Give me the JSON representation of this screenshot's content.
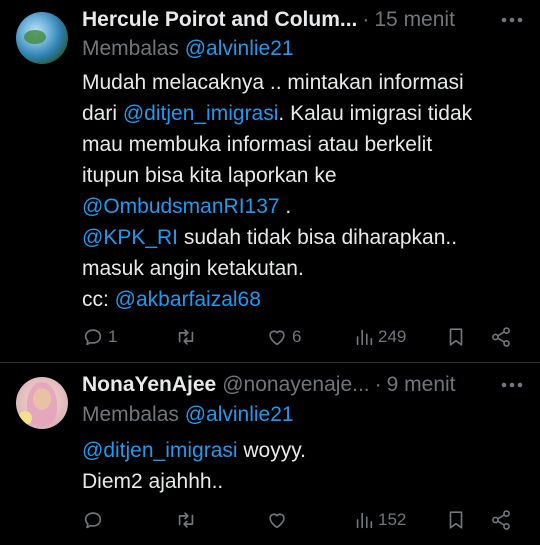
{
  "tweets": [
    {
      "author_name": "Hercule Poirot and Colum...",
      "handle": "",
      "separator": "·",
      "time": "15 menit",
      "replying_label": "Membalas",
      "replying_to": "@alvinlie21",
      "body_lines": [
        [
          {
            "t": "Mudah melacaknya .. mintakan informasi",
            "m": false
          }
        ],
        [
          {
            "t": "dari ",
            "m": false
          },
          {
            "t": "@ditjen_imigrasi",
            "m": true
          },
          {
            "t": ". Kalau imigrasi tidak",
            "m": false
          }
        ],
        [
          {
            "t": "mau membuka informasi atau berkelit",
            "m": false
          }
        ],
        [
          {
            "t": "itupun bisa kita laporkan ke",
            "m": false
          }
        ],
        [
          {
            "t": "@OmbudsmanRI137",
            "m": true
          },
          {
            "t": " .",
            "m": false
          }
        ],
        [
          {
            "t": "@KPK_RI",
            "m": true
          },
          {
            "t": " sudah tidak bisa diharapkan..",
            "m": false
          }
        ],
        [
          {
            "t": "masuk angin ketakutan.",
            "m": false
          }
        ],
        [
          {
            "t": "cc: ",
            "m": false
          },
          {
            "t": "@akbarfaizal68",
            "m": true
          }
        ]
      ],
      "actions": {
        "replies": "1",
        "retweets": "",
        "likes": "6",
        "views": "249"
      },
      "avatar_icon": "globe-avatar"
    },
    {
      "author_name": "NonaYenAjee",
      "handle": "@nonayenaje...",
      "separator": "·",
      "time": "9 menit",
      "replying_label": "Membalas",
      "replying_to": "@alvinlie21",
      "body_lines": [
        [
          {
            "t": "@ditjen_imigrasi",
            "m": true
          },
          {
            "t": " woyyy.",
            "m": false
          }
        ],
        [
          {
            "t": " Diem2 ajahhh..",
            "m": false
          }
        ]
      ],
      "actions": {
        "replies": "",
        "retweets": "",
        "likes": "",
        "views": "152"
      },
      "avatar_icon": "user-avatar"
    }
  ],
  "colors": {
    "background": "#000000",
    "text": "#e7e9ea",
    "secondary": "#71767b",
    "mention": "#1d9bf0",
    "divider": "#2f3336"
  }
}
